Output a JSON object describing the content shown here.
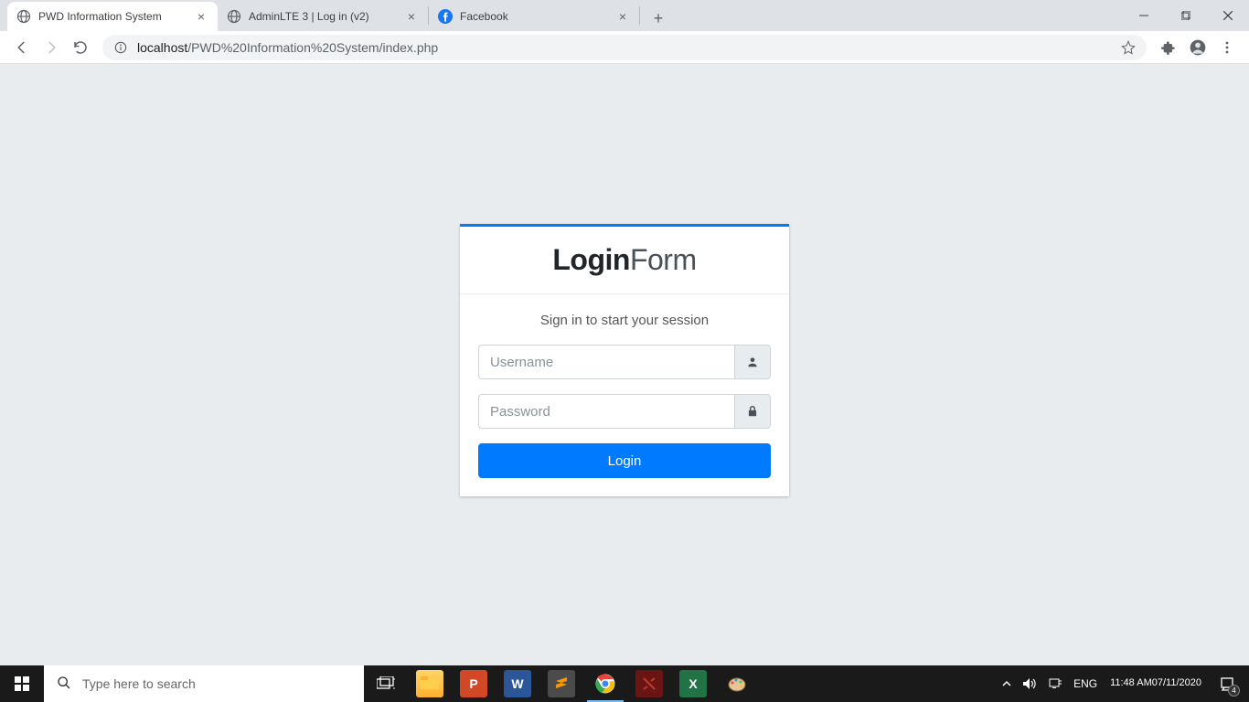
{
  "browser": {
    "tabs": [
      {
        "title": "PWD Information System",
        "active": true,
        "favicon": "globe"
      },
      {
        "title": "AdminLTE 3 | Log in (v2)",
        "active": false,
        "favicon": "globe"
      },
      {
        "title": "Facebook",
        "active": false,
        "favicon": "facebook"
      }
    ],
    "url_host": "localhost",
    "url_path": "/PWD%20Information%20System/index.php"
  },
  "login": {
    "brand_bold": "Login",
    "brand_light": "Form",
    "message": "Sign in to start your session",
    "username_placeholder": "Username",
    "password_placeholder": "Password",
    "submit_label": "Login"
  },
  "taskbar": {
    "search_placeholder": "Type here to search",
    "lang": "ENG",
    "time": "11:48 AM",
    "date": "07/11/2020",
    "notif_count": "4"
  }
}
